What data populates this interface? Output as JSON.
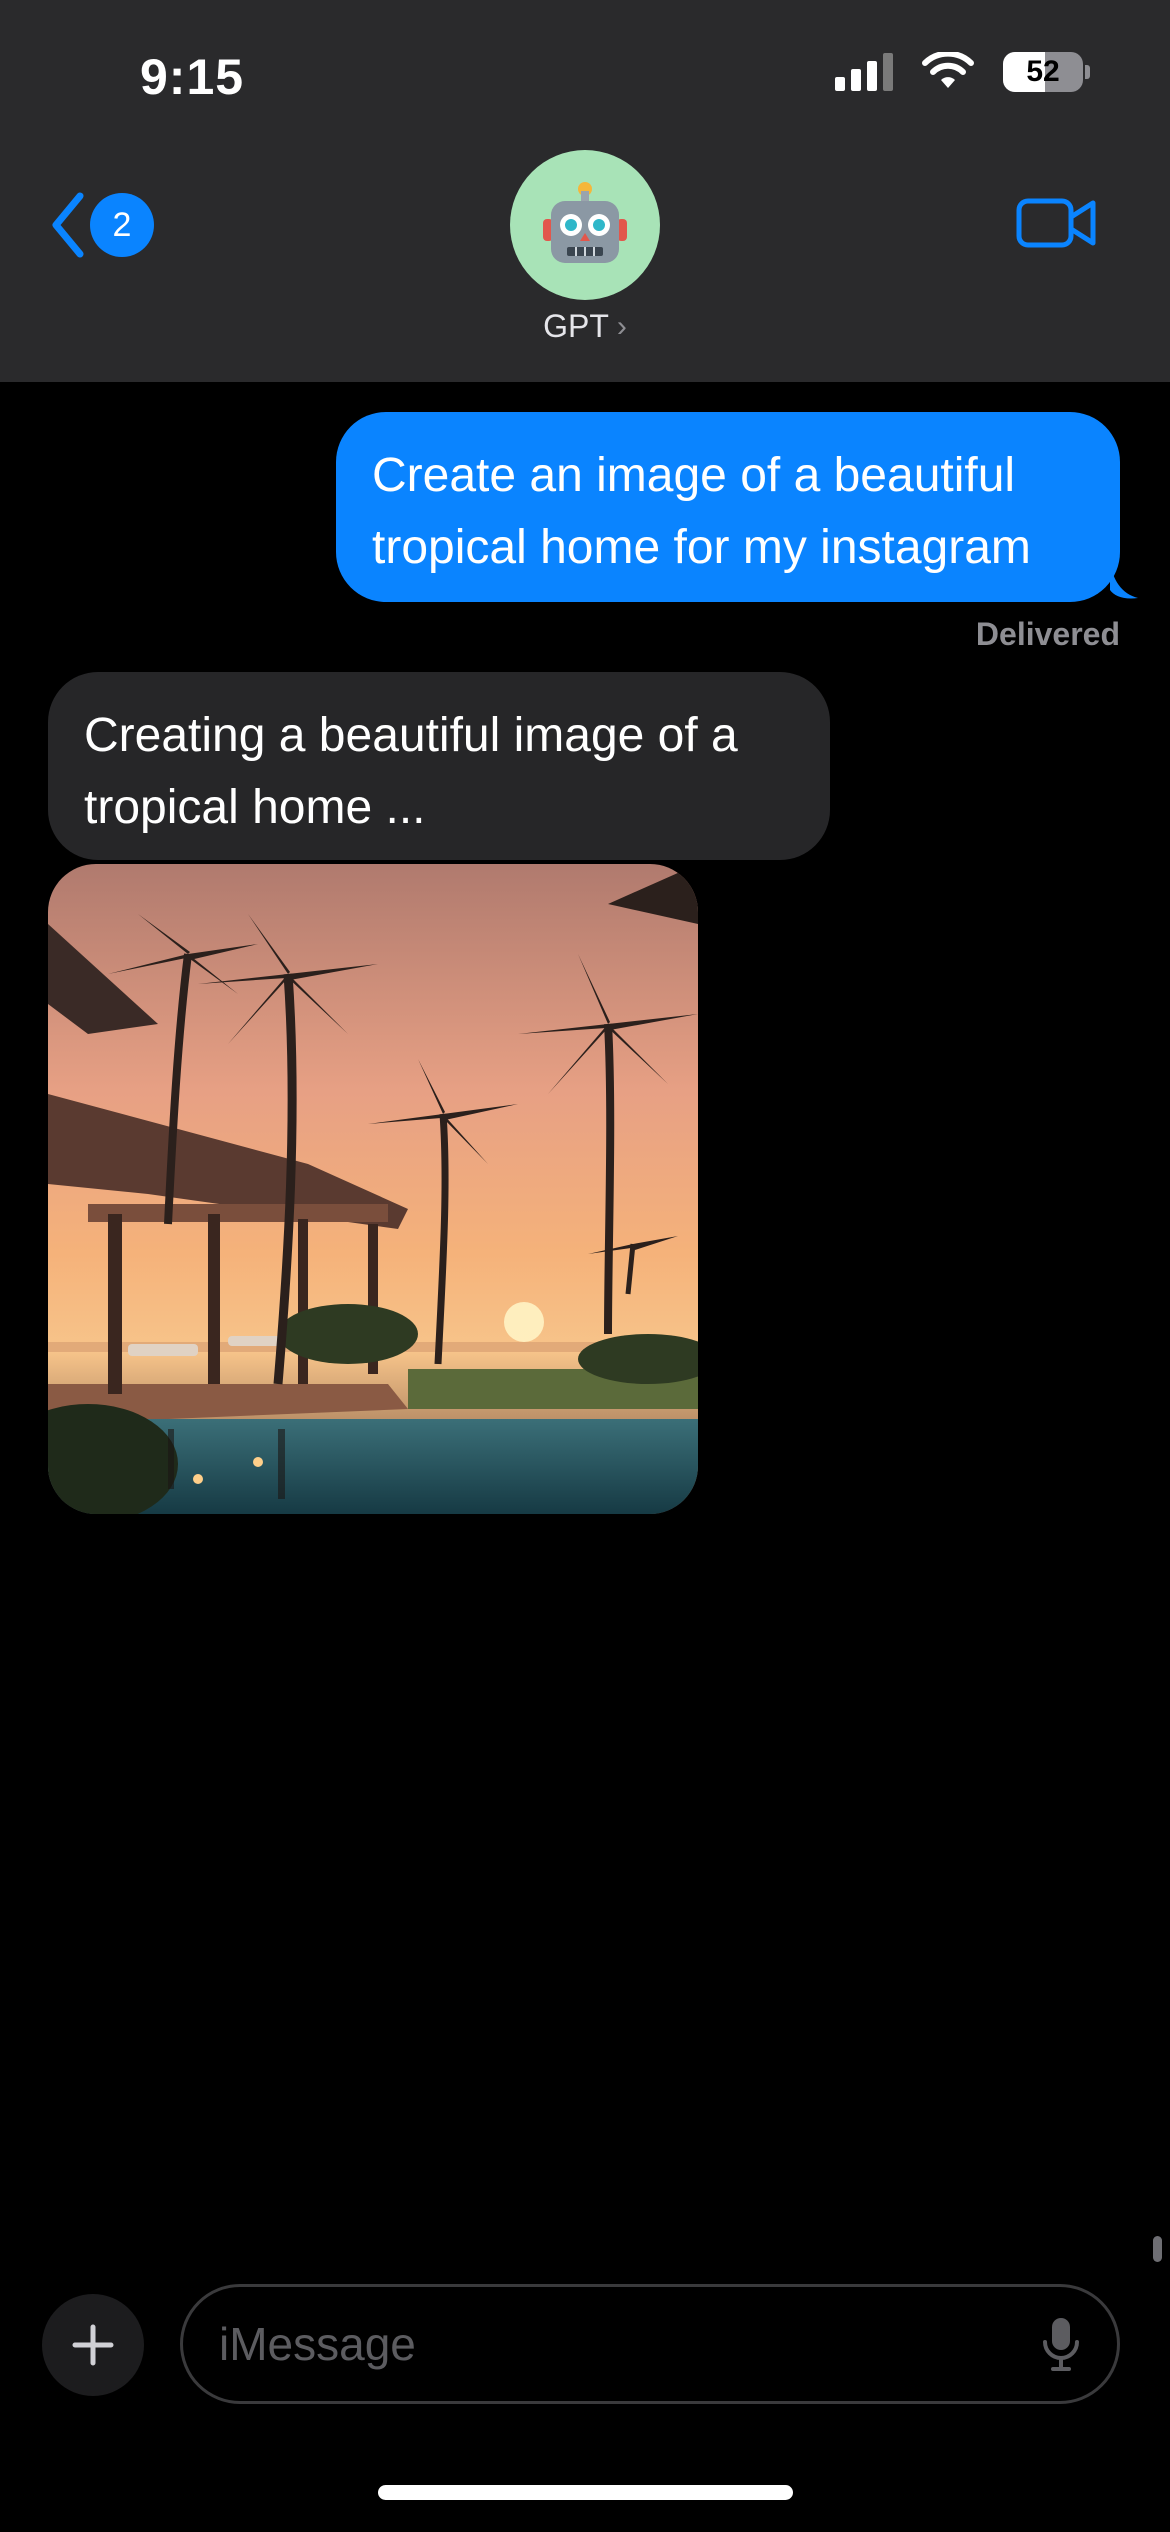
{
  "status_bar": {
    "time": "9:15",
    "battery": "52",
    "icons": [
      "cellular-signal-icon",
      "wifi-icon",
      "battery-icon"
    ]
  },
  "header": {
    "back_badge": "2",
    "contact_name": "GPT",
    "contact_avatar": "robot-face-icon",
    "video_icon": "video-camera-icon",
    "accent": "#0a84ff"
  },
  "messages": [
    {
      "from": "me",
      "text": "Create an image of a beautiful tropical home for my instagram",
      "status": "Delivered"
    },
    {
      "from": "them",
      "text": "Creating a beautiful image of a tropical home ..."
    },
    {
      "from": "them",
      "type": "image",
      "subject": "tropical home with palm trees at sunset"
    }
  ],
  "composer": {
    "placeholder": "iMessage",
    "plus_icon": "plus-icon",
    "mic_icon": "microphone-icon"
  }
}
